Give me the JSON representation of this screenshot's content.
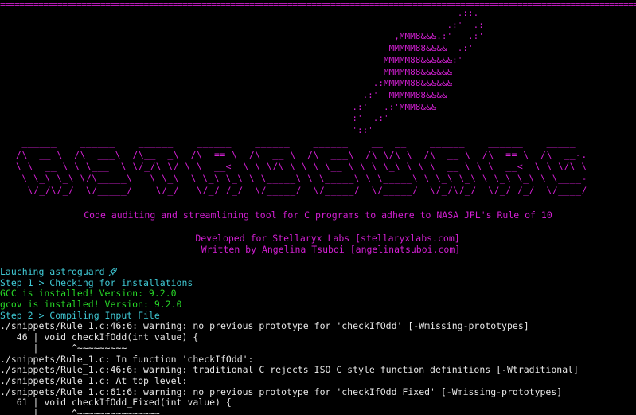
{
  "terminal": {
    "rule": "====================================================================================================================================================================================================",
    "rocket_art": "                                           .::.\n                                         .:'  .:\n                               ,MMM8&&&.:'   .:'\n                              MMMMM88&&&&  .:'\n                             MMMMM88&&&&&&:'\n                             MMMMM88&&&&&&\n                           .:MMMMM88&&&&&&\n                         .:'  MMMMM88&&&&\n                       .:'   .:'MMM8&&&'\n                       :'  .:'\n                       '::'",
    "banner_art": " ______    ______    ______    ______    ______    ______    __  __    ______    ______    _____\n/\\  __ \\  /\\  ___\\  /\\__  _\\  /\\  == \\  /\\  __ \\  /\\  ___\\  /\\ \\/\\ \\  /\\  __ \\  /\\  == \\  /\\  __-.\n\\ \\  __ \\ \\ \\___  \\ \\/_/\\ \\/ \\ \\  __<  \\ \\ \\/\\ \\ \\ \\ \\__ \\ \\ \\ \\_\\ \\ \\ \\  __ \\ \\ \\  __<  \\ \\ \\/\\ \\\n \\ \\_\\ \\_\\ \\/\\_____\\   \\ \\_\\  \\ \\_\\ \\_\\ \\ \\_____\\ \\ \\_____\\ \\ \\_____\\ \\ \\_\\ \\_\\ \\ \\_\\ \\_\\ \\ \\____-\n  \\/_/\\/_/  \\/_____/    \\/_/   \\/_/ /_/  \\/_____/  \\/_____/  \\/_____/  \\/_/\\/_/  \\/_/ /_/  \\/____/",
    "tagline": "Code auditing and streamlining tool for C programs to adhere to NASA JPL's Rule of 10",
    "developed_by": "Developed for Stellaryx Labs [stellaryxlabs.com]",
    "written_by": "Written by Angelina Tsuboi [angelinatsuboi.com]",
    "launch_line": "Lauching astroguard",
    "launch_icon": "rocket-icon",
    "log": [
      {
        "text": "Step 1 > Checking for installations",
        "color": "cyan"
      },
      {
        "text": "GCC is installed! Version: 9.2.0",
        "color": "green"
      },
      {
        "text": "gcov is installed! Version: 9.2.0",
        "color": "green"
      },
      {
        "text": "Step 2 > Compiling Input File",
        "color": "cyan"
      },
      {
        "text": "./snippets/Rule_1.c:46:6: warning: no previous prototype for 'checkIfOdd' [-Wmissing-prototypes]",
        "color": "white"
      },
      {
        "text": "   46 | void checkIfOdd(int value) {",
        "color": "white"
      },
      {
        "text": "      |      ^~~~~~~~~~",
        "color": "white"
      },
      {
        "text": "./snippets/Rule_1.c: In function 'checkIfOdd':",
        "color": "white"
      },
      {
        "text": "./snippets/Rule_1.c:46:6: warning: traditional C rejects ISO C style function definitions [-Wtraditional]",
        "color": "white"
      },
      {
        "text": "./snippets/Rule_1.c: At top level:",
        "color": "white"
      },
      {
        "text": "./snippets/Rule_1.c:61:6: warning: no previous prototype for 'checkIfOdd_Fixed' [-Wmissing-prototypes]",
        "color": "white"
      },
      {
        "text": "   61 | void checkIfOdd_Fixed(int value) {",
        "color": "white"
      },
      {
        "text": "      |      ^~~~~~~~~~~~~~~~",
        "color": "white"
      }
    ],
    "colors": {
      "magenta": "#d21fd2",
      "cyan": "#3fc8d4",
      "green": "#28d828",
      "white": "#e6e6e6",
      "background": "#000000"
    }
  }
}
